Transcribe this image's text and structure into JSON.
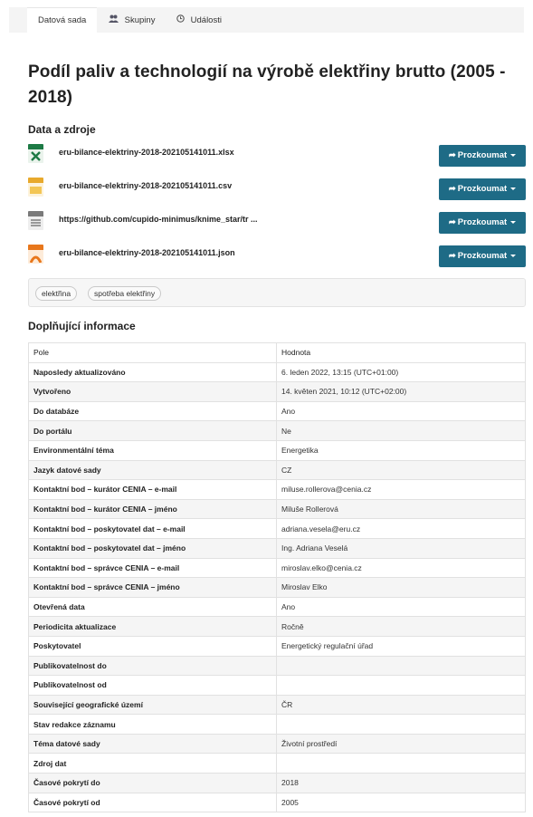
{
  "tabs": [
    {
      "label": "Datová sada",
      "icon": ""
    },
    {
      "label": "Skupiny",
      "icon": "users-icon"
    },
    {
      "label": "Události",
      "icon": "clock-icon"
    }
  ],
  "dataset_title": "Podíl paliv a technologií na výrobě elektřiny brutto (2005 - 2018)",
  "resources_heading": "Data a zdroje",
  "resources": [
    {
      "name": "eru-bilance-elektriny-2018-202105141011.xlsx",
      "format": "XLS",
      "icon": "xlsx-file-icon",
      "color": "#1d7a45"
    },
    {
      "name": "eru-bilance-elektriny-2018-202105141011.csv",
      "format": "CSV",
      "icon": "csv-file-icon",
      "color": "#e8a92c"
    },
    {
      "name": "https://github.com/cupido-minimus/knime_star/tr ...",
      "format": "DATA",
      "icon": "data-file-icon",
      "color": "#7a7a7a"
    },
    {
      "name": "eru-bilance-elektriny-2018-202105141011.json",
      "format": "JSON",
      "icon": "json-file-icon",
      "color": "#e8771c"
    }
  ],
  "explore_label": "Prozkoumat",
  "tags": [
    "elektřina",
    "spotřeba elektřiny"
  ],
  "info_heading": "Doplňující informace",
  "info_table": {
    "headers": [
      "Pole",
      "Hodnota"
    ],
    "rows": [
      [
        "Naposledy aktualizováno",
        "6. leden 2022, 13:15 (UTC+01:00)"
      ],
      [
        "Vytvořeno",
        "14. květen 2021, 10:12 (UTC+02:00)"
      ],
      [
        "Do databáze",
        "Ano"
      ],
      [
        "Do portálu",
        "Ne"
      ],
      [
        "Environmentální téma",
        "Energetika"
      ],
      [
        "Jazyk datové sady",
        "CZ"
      ],
      [
        "Kontaktní bod – kurátor CENIA – e-mail",
        "miluse.rollerova@cenia.cz"
      ],
      [
        "Kontaktní bod – kurátor CENIA – jméno",
        "Miluše Rollerová"
      ],
      [
        "Kontaktní bod – poskytovatel dat – e-mail",
        "adriana.vesela@eru.cz"
      ],
      [
        "Kontaktní bod – poskytovatel dat – jméno",
        "Ing. Adriana Veselá"
      ],
      [
        "Kontaktní bod – správce CENIA – e-mail",
        "miroslav.elko@cenia.cz"
      ],
      [
        "Kontaktní bod – správce CENIA – jméno",
        "Miroslav Elko"
      ],
      [
        "Otevřená data",
        "Ano"
      ],
      [
        "Periodicita aktualizace",
        "Ročně"
      ],
      [
        "Poskytovatel",
        "Energetický regulační úřad"
      ],
      [
        "Publikovatelnost do",
        ""
      ],
      [
        "Publikovatelnost od",
        ""
      ],
      [
        "Související geografické území",
        "ČR"
      ],
      [
        "Stav redakce záznamu",
        ""
      ],
      [
        "Téma datové sady",
        "Životní prostředí"
      ],
      [
        "Zdroj dat",
        ""
      ],
      [
        "Časové pokrytí do",
        "2018"
      ],
      [
        "Časové pokrytí od",
        "2005"
      ]
    ]
  }
}
